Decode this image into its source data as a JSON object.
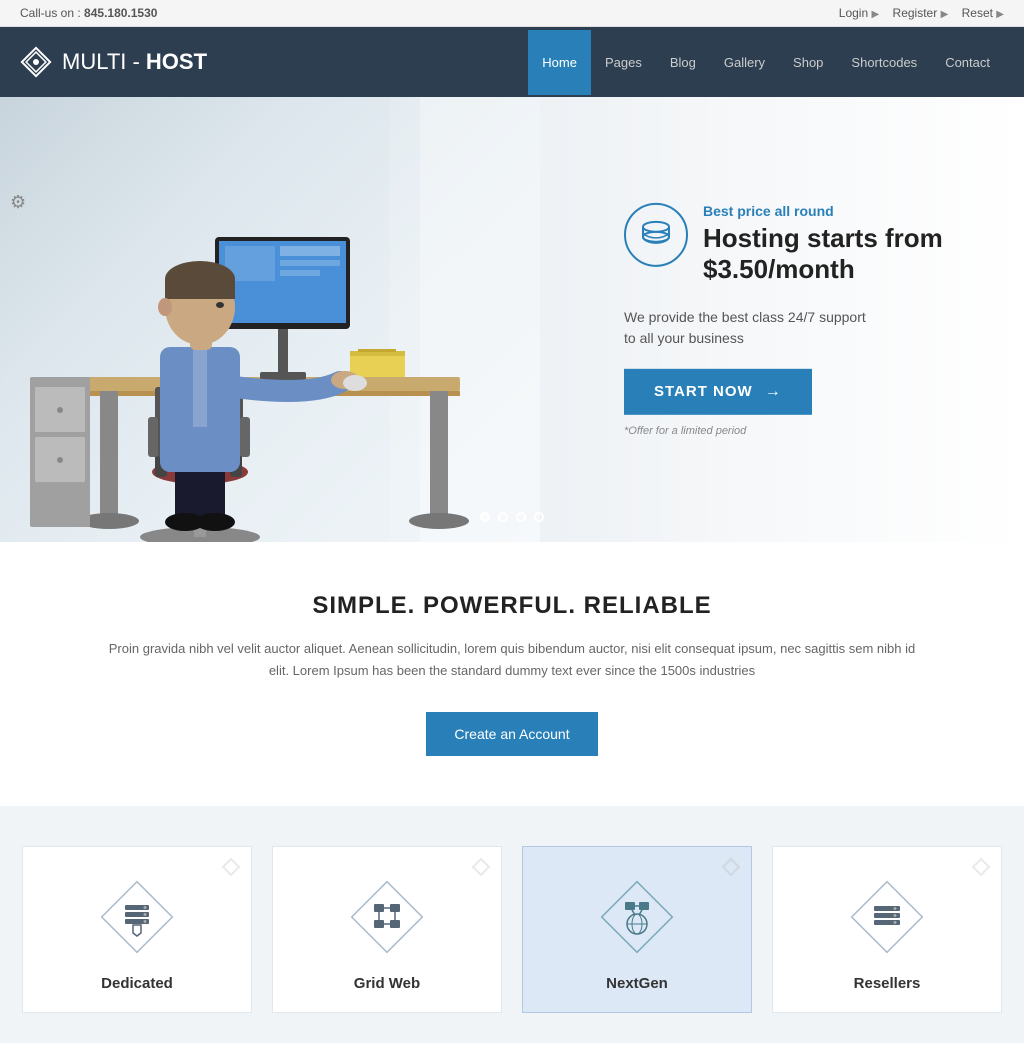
{
  "topbar": {
    "callus_label": "Call-us on :",
    "phone": "845.180.1530",
    "links": [
      {
        "label": "Login",
        "arrow": "▶"
      },
      {
        "label": "Register",
        "arrow": "▶"
      },
      {
        "label": "Reset",
        "arrow": "▶"
      }
    ]
  },
  "navbar": {
    "logo": {
      "text_multi": "MULTI - ",
      "text_host": "HOST"
    },
    "nav_items": [
      {
        "label": "Home",
        "active": true
      },
      {
        "label": "Pages",
        "active": false
      },
      {
        "label": "Blog",
        "active": false
      },
      {
        "label": "Gallery",
        "active": false
      },
      {
        "label": "Shop",
        "active": false
      },
      {
        "label": "Shortcodes",
        "active": false
      },
      {
        "label": "Contact",
        "active": false
      }
    ]
  },
  "hero": {
    "tagline": "Best price all round",
    "title": "Hosting starts from $3.50/month",
    "description": "We provide the best class 24/7 support\nto all your business",
    "cta_label": "START NOW",
    "offer_text": "*Offer for a limited period"
  },
  "middle": {
    "title": "SIMPLE. POWERFUL. RELIABLE",
    "description": "Proin gravida nibh vel velit auctor aliquet. Aenean sollicitudin, lorem quis bibendum auctor, nisi elit consequat ipsum, nec sagittis sem nibh id elit. Lorem Ipsum has been the  standard dummy text ever since the 1500s industries",
    "cta_label": "Create an Account"
  },
  "services": {
    "items": [
      {
        "name": "Dedicated",
        "icon": "🖥",
        "highlighted": false
      },
      {
        "name": "Grid Web",
        "icon": "🔗",
        "highlighted": false
      },
      {
        "name": "NextGen",
        "icon": "🌐",
        "highlighted": true
      },
      {
        "name": "Resellers",
        "icon": "🖥",
        "highlighted": false
      }
    ]
  }
}
